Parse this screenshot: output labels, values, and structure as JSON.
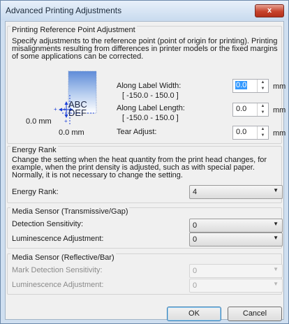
{
  "window": {
    "title": "Advanced Printing Adjustments",
    "close_label": "x"
  },
  "reference": {
    "title": "Printing Reference Point Adjustment",
    "description": "Specify adjustments to the reference point (point of origin for printing). Printing misalignments resulting from differences in printer models or the fixed margins of some applications can be corrected.",
    "diagram": {
      "text_line1": "ABC",
      "text_line2": "DEF",
      "y_origin": "0.0 mm",
      "x_origin": "0.0 mm"
    },
    "width": {
      "label": "Along Label Width:",
      "range": "[ -150.0 - 150.0 ]",
      "value": "0.0",
      "unit": "mm"
    },
    "length": {
      "label": "Along Label Length:",
      "range": "[ -150.0 - 150.0 ]",
      "value": "0.0",
      "unit": "mm"
    },
    "tear": {
      "label": "Tear Adjust:",
      "value": "0.0",
      "unit": "mm"
    }
  },
  "energy": {
    "title": "Energy Rank",
    "description": "Change the setting when the heat quantity from the print head changes, for example, when the print density is adjusted, such as with special paper. Normally, it is not necessary to change the setting.",
    "label": "Energy Rank:",
    "value": "4"
  },
  "trans": {
    "title": "Media Sensor (Transmissive/Gap)",
    "detection_label": "Detection Sensitivity:",
    "detection_value": "0",
    "luminescence_label": "Luminescence Adjustment:",
    "luminescence_value": "0"
  },
  "refl": {
    "title": "Media Sensor (Reflective/Bar)",
    "mark_label": "Mark Detection Sensitivity:",
    "mark_value": "0",
    "luminescence_label": "Luminescence Adjustment:",
    "luminescence_value": "0"
  },
  "buttons": {
    "ok": "OK",
    "cancel": "Cancel"
  },
  "icons": {
    "spin_up": "up-arrow-icon",
    "spin_down": "down-arrow-icon",
    "dropdown": "chevron-down-icon",
    "close": "close-icon"
  },
  "colors": {
    "selection": "#3399ff",
    "close_button": "#c7432d",
    "diagram_arrow": "#1a3fd8"
  }
}
